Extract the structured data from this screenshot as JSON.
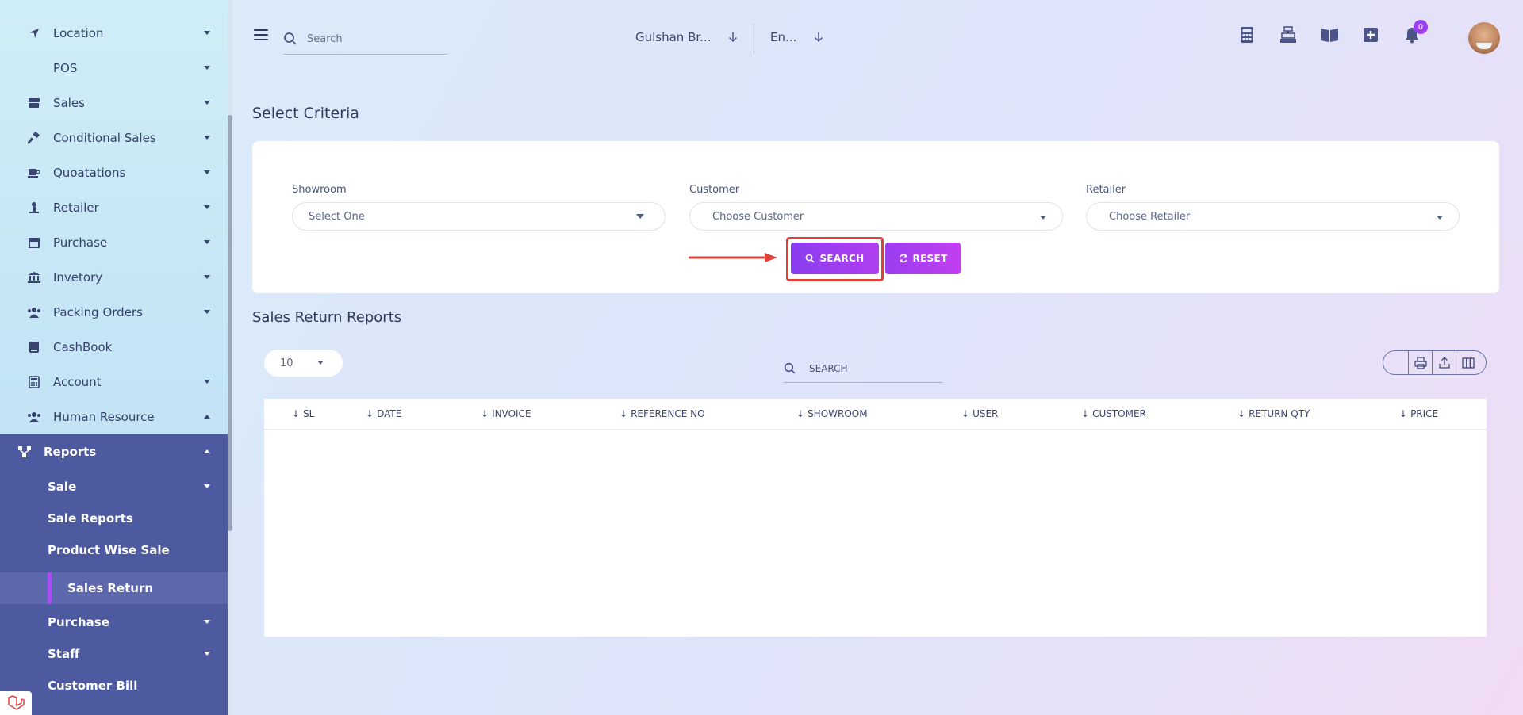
{
  "sidebar": {
    "items": [
      {
        "label": "Location",
        "icon": "location-arrow-icon",
        "caret": "down"
      },
      {
        "label": "POS",
        "icon": "",
        "caret": "down"
      },
      {
        "label": "Sales",
        "icon": "store-icon",
        "caret": "down"
      },
      {
        "label": "Conditional Sales",
        "icon": "hammer-icon",
        "caret": "down"
      },
      {
        "label": "Quoatations",
        "icon": "mug-icon",
        "caret": "down"
      },
      {
        "label": "Retailer",
        "icon": "person-icon",
        "caret": "down"
      },
      {
        "label": "Purchase",
        "icon": "shop-icon",
        "caret": "down"
      },
      {
        "label": "Invetory",
        "icon": "bank-icon",
        "caret": "down"
      },
      {
        "label": "Packing Orders",
        "icon": "users-icon",
        "caret": "down"
      },
      {
        "label": "CashBook",
        "icon": "book-icon",
        "caret": ""
      },
      {
        "label": "Account",
        "icon": "calculator-icon",
        "caret": "down"
      },
      {
        "label": "Human Resource",
        "icon": "users-icon",
        "caret": "up"
      }
    ],
    "reports": {
      "label": "Reports",
      "children": [
        {
          "label": "Sale",
          "caret": "down"
        },
        {
          "label": "Sale Reports",
          "caret": ""
        },
        {
          "label": "Product Wise Sale",
          "caret": ""
        },
        {
          "label": "Sales Return",
          "caret": "",
          "active": true
        },
        {
          "label": "Purchase",
          "caret": "down"
        },
        {
          "label": "Staff",
          "caret": "down"
        },
        {
          "label": "Customer Bill",
          "caret": ""
        }
      ]
    }
  },
  "topbar": {
    "search_placeholder": "Search",
    "branch": "Gulshan Br...",
    "language": "En...",
    "notification_count": "0"
  },
  "criteria": {
    "title": "Select Criteria",
    "showroom_label": "Showroom",
    "showroom_value": "Select One",
    "customer_label": "Customer",
    "customer_value": "Choose Customer",
    "retailer_label": "Retailer",
    "retailer_value": "Choose Retailer",
    "search_button": "SEARCH",
    "reset_button": "RESET"
  },
  "report": {
    "title": "Sales Return Reports",
    "per_page": "10",
    "search_placeholder": "SEARCH",
    "columns": [
      "SL",
      "DATE",
      "INVOICE",
      "REFERENCE NO",
      "SHOWROOM",
      "USER",
      "CUSTOMER",
      "RETURN QTY",
      "PRICE"
    ]
  },
  "colors": {
    "accent": "#9b3ff0",
    "sidebar_active": "#4d5aa0",
    "highlight": "#e0403a"
  }
}
